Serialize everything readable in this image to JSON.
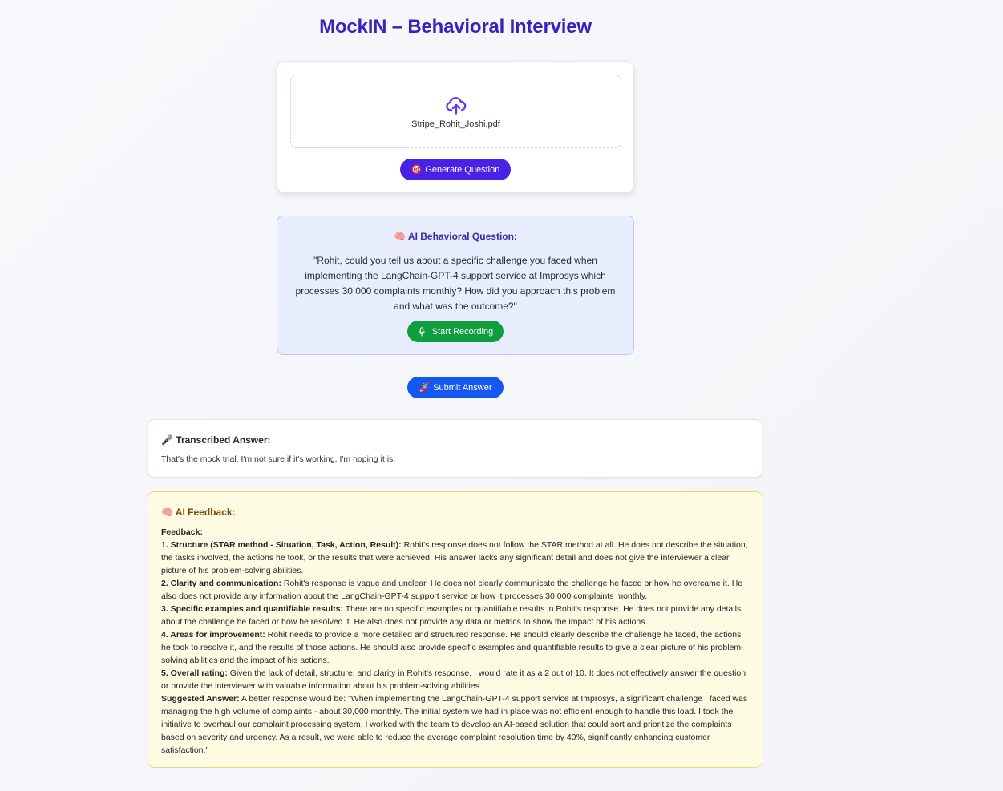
{
  "app": {
    "title": "MockIN – Behavioral Interview"
  },
  "upload": {
    "icon": "upload-cloud-icon",
    "file_name": "Stripe_Rohit_Joshi.pdf",
    "generate_label": "Generate Question",
    "generate_emoji": "🎯"
  },
  "question": {
    "emoji": "🧠",
    "heading": "AI Behavioral Question:",
    "text": "\"Rohit, could you tell us about a specific challenge you faced when implementing the LangChain-GPT-4 support service at Improsys which processes 30,000 complaints monthly? How did you approach this problem and what was the outcome?\"",
    "record_label": "Start Recording",
    "record_icon": "microphone-icon"
  },
  "submit": {
    "emoji": "🚀",
    "label": "Submit Answer"
  },
  "transcript": {
    "emoji": "🎤",
    "heading": "Transcribed Answer:",
    "text": "That's the mock trial, I'm not sure if it's working, I'm hoping it is."
  },
  "feedback": {
    "emoji": "🧠",
    "heading": "AI Feedback:",
    "intro": "Feedback:",
    "items": [
      {
        "label": "1. Structure (STAR method - Situation, Task, Action, Result):",
        "text": " Rohit's response does not follow the STAR method at all. He does not describe the situation, the tasks involved, the actions he took, or the results that were achieved. His answer lacks any significant detail and does not give the interviewer a clear picture of his problem-solving abilities."
      },
      {
        "label": "2. Clarity and communication:",
        "text": " Rohit's response is vague and unclear. He does not clearly communicate the challenge he faced or how he overcame it. He also does not provide any information about the LangChain-GPT-4 support service or how it processes 30,000 complaints monthly."
      },
      {
        "label": "3. Specific examples and quantifiable results:",
        "text": " There are no specific examples or quantifiable results in Rohit's response. He does not provide any details about the challenge he faced or how he resolved it. He also does not provide any data or metrics to show the impact of his actions."
      },
      {
        "label": "4. Areas for improvement:",
        "text": " Rohit needs to provide a more detailed and structured response. He should clearly describe the challenge he faced, the actions he took to resolve it, and the results of those actions. He should also provide specific examples and quantifiable results to give a clear picture of his problem-solving abilities and the impact of his actions."
      },
      {
        "label": "5. Overall rating:",
        "text": " Given the lack of detail, structure, and clarity in Rohit's response, I would rate it as a 2 out of 10. It does not effectively answer the question or provide the interviewer with valuable information about his problem-solving abilities."
      },
      {
        "label": "Suggested Answer:",
        "text": " A better response would be: \"When implementing the LangChain-GPT-4 support service at Improsys, a significant challenge I faced was managing the high volume of complaints - about 30,000 monthly. The initial system we had in place was not efficient enough to handle this load. I took the initiative to overhaul our complaint processing system. I worked with the team to develop an AI-based solution that could sort and prioritize the complaints based on severity and urgency. As a result, we were able to reduce the average complaint resolution time by 40%, significantly enhancing customer satisfaction.\""
      }
    ]
  },
  "colors": {
    "title": "#3b1fc1",
    "generate_button": "#4a22e6",
    "record_button": "#0f9d3d",
    "submit_button": "#1557f0",
    "question_bg": "#e9eefe",
    "feedback_bg": "#fefbe3"
  }
}
